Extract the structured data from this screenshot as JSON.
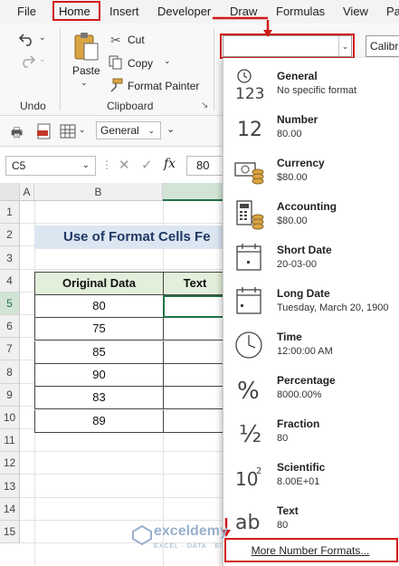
{
  "menu": [
    "File",
    "Home",
    "Insert",
    "Developer",
    "Draw",
    "Formulas",
    "View",
    "Pa"
  ],
  "ribbon": {
    "undo_label": "Undo",
    "paste_label": "Paste",
    "cut_label": "Cut",
    "copy_label": "Copy",
    "format_painter_label": "Format Painter",
    "clipboard_label": "Clipboard",
    "number_format_value": "",
    "font_value": "Calibr"
  },
  "quick_access": {
    "number_format": "General"
  },
  "formula_bar": {
    "name_box": "C5",
    "fx": "fx",
    "value": "80"
  },
  "grid": {
    "columns": [
      "A",
      "B"
    ],
    "rows": [
      "1",
      "2",
      "3",
      "4",
      "5",
      "6",
      "7",
      "8",
      "9",
      "10",
      "11",
      "12",
      "13",
      "14",
      "15"
    ],
    "title": "Use of Format Cells Fe",
    "headers": [
      "Original Data",
      "Text"
    ],
    "original_data": [
      "80",
      "75",
      "85",
      "90",
      "83",
      "89"
    ]
  },
  "number_formats": [
    {
      "name": "General",
      "sample": "No specific format",
      "icon": "general-123-icon"
    },
    {
      "name": "Number",
      "sample": "80.00",
      "icon": "number-12-icon"
    },
    {
      "name": "Currency",
      "sample": "$80.00",
      "icon": "currency-icon"
    },
    {
      "name": "Accounting",
      "sample": " $80.00",
      "icon": "accounting-icon"
    },
    {
      "name": "Short Date",
      "sample": "20-03-00",
      "icon": "short-date-icon"
    },
    {
      "name": "Long Date",
      "sample": "Tuesday, March 20, 1900",
      "icon": "long-date-icon"
    },
    {
      "name": "Time",
      "sample": "12:00:00 AM",
      "icon": "clock-icon"
    },
    {
      "name": "Percentage",
      "sample": "8000.00%",
      "icon": "percent-icon"
    },
    {
      "name": "Fraction",
      "sample": "80",
      "icon": "fraction-icon"
    },
    {
      "name": "Scientific",
      "sample": "8.00E+01",
      "icon": "scientific-icon"
    },
    {
      "name": "Text",
      "sample": "80",
      "icon": "text-ab-icon"
    }
  ],
  "more_formats_label": "More Number Formats...",
  "watermark": {
    "name": "exceldemy",
    "tagline": "EXCEL · DATA · BI"
  },
  "colors": {
    "highlight": "#d11a1a",
    "accent": "#217346",
    "title_fill": "#dce6f1",
    "header_fill": "#e2efda"
  }
}
